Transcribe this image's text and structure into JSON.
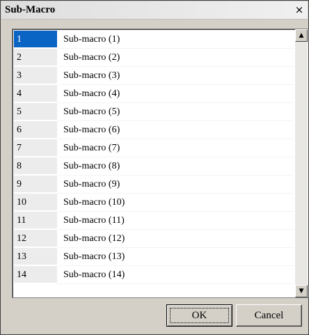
{
  "window": {
    "title": "Sub-Macro",
    "close_glyph": "×"
  },
  "list": {
    "selected_index": 0,
    "items": [
      {
        "index": "1",
        "name": "Sub-macro (1)"
      },
      {
        "index": "2",
        "name": "Sub-macro (2)"
      },
      {
        "index": "3",
        "name": "Sub-macro (3)"
      },
      {
        "index": "4",
        "name": "Sub-macro (4)"
      },
      {
        "index": "5",
        "name": "Sub-macro (5)"
      },
      {
        "index": "6",
        "name": "Sub-macro (6)"
      },
      {
        "index": "7",
        "name": "Sub-macro (7)"
      },
      {
        "index": "8",
        "name": "Sub-macro (8)"
      },
      {
        "index": "9",
        "name": "Sub-macro (9)"
      },
      {
        "index": "10",
        "name": "Sub-macro (10)"
      },
      {
        "index": "11",
        "name": "Sub-macro (11)"
      },
      {
        "index": "12",
        "name": "Sub-macro (12)"
      },
      {
        "index": "13",
        "name": "Sub-macro (13)"
      },
      {
        "index": "14",
        "name": "Sub-macro (14)"
      }
    ]
  },
  "scrollbar": {
    "up_glyph": "▲",
    "down_glyph": "▼"
  },
  "buttons": {
    "ok_label": "OK",
    "cancel_label": "Cancel"
  },
  "colors": {
    "selection": "#0a64c4",
    "dialog_face": "#d4d0c8"
  }
}
